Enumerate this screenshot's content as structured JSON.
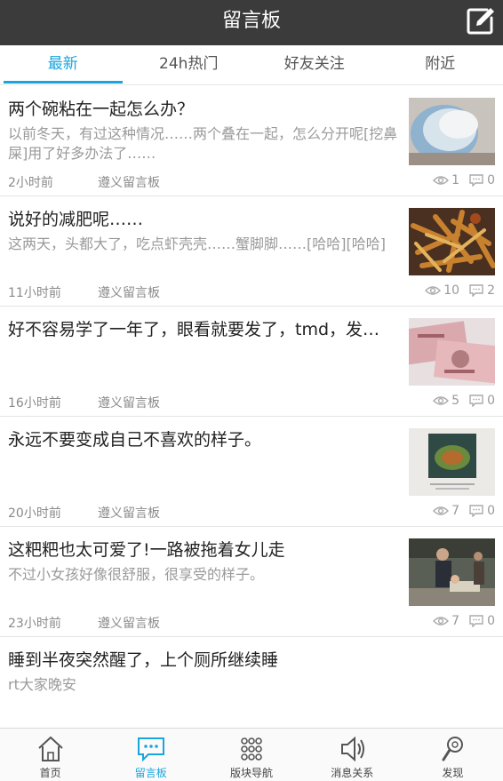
{
  "header": {
    "title": "留言板"
  },
  "tabs": [
    {
      "label": "最新",
      "active": true
    },
    {
      "label": "24h热门",
      "active": false
    },
    {
      "label": "好友关注",
      "active": false
    },
    {
      "label": "附近",
      "active": false
    }
  ],
  "posts": [
    {
      "title": "两个碗粘在一起怎么办？",
      "excerpt": "以前冬天，有过这种情况……两个叠在一起，怎么分开呢[挖鼻屎]用了好多办法了……",
      "time": "2小时前",
      "board": "遵义留言板",
      "views": "1",
      "comments": "0",
      "thumb": "bowls"
    },
    {
      "title": "说好的减肥呢……",
      "excerpt": "这两天，头都大了，吃点虾壳壳……蟹脚脚……[哈哈][哈哈]",
      "time": "11小时前",
      "board": "遵义留言板",
      "views": "10",
      "comments": "2",
      "thumb": "food"
    },
    {
      "title": "好不容易学了一年了，眼看就要发了，tmd，发…",
      "excerpt": "",
      "time": "16小时前",
      "board": "遵义留言板",
      "views": "5",
      "comments": "0",
      "thumb": "money"
    },
    {
      "title": "永远不要变成自己不喜欢的样子。",
      "excerpt": "",
      "time": "20小时前",
      "board": "遵义留言板",
      "views": "7",
      "comments": "0",
      "thumb": "book"
    },
    {
      "title": "这粑粑也太可爱了!一路被拖着女儿走",
      "excerpt": "不过小女孩好像很舒服，很享受的样子。",
      "time": "23小时前",
      "board": "遵义留言板",
      "views": "7",
      "comments": "0",
      "thumb": "street"
    },
    {
      "title": "睡到半夜突然醒了，上个厕所继续睡",
      "excerpt": "rt大家晚安",
      "time": "",
      "board": "",
      "views": "",
      "comments": "",
      "thumb": ""
    }
  ],
  "bottom_nav": [
    {
      "label": "首页",
      "icon": "home-icon",
      "active": false
    },
    {
      "label": "留言板",
      "icon": "message-board-icon",
      "active": true
    },
    {
      "label": "版块导航",
      "icon": "grid-icon",
      "active": false
    },
    {
      "label": "消息关系",
      "icon": "speaker-icon",
      "active": false
    },
    {
      "label": "发现",
      "icon": "discover-icon",
      "active": false
    }
  ],
  "colors": {
    "accent": "#1aa5dd",
    "header_bg": "#3b3b3b"
  }
}
